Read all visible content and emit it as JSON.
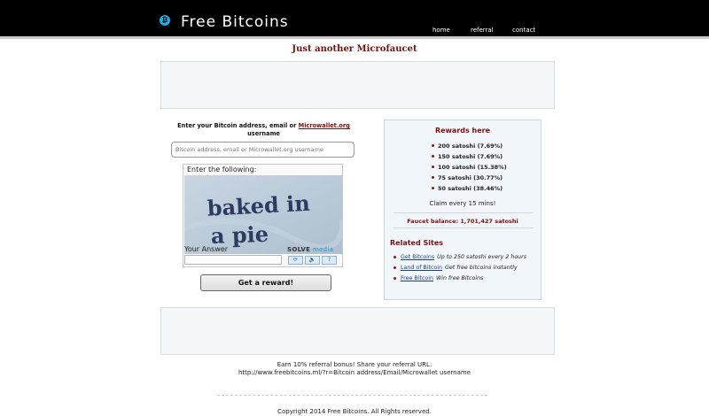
{
  "header": {
    "logo_glyph": "₿",
    "title": "Free Bitcoins",
    "nav": {
      "home": "home",
      "referral": "referral",
      "contact": "contact"
    }
  },
  "subtitle": "Just another Microfaucet",
  "form": {
    "label_prefix": "Enter your Bitcoin address, email or ",
    "label_link": "Microwallet.org",
    "label_suffix": " username",
    "address_placeholder": "Bitcoin address, email or Microwallet.org username",
    "address_value": ""
  },
  "captcha": {
    "prompt": "Enter the following:",
    "challenge_line1": "baked in",
    "challenge_line2": "a pie",
    "answer_label": "Your Answer",
    "brand_bold": "SOLVE",
    "brand_light": "media",
    "refresh_glyph": "⟳",
    "audio_glyph": "🔈",
    "help_glyph": "?"
  },
  "reward_button_label": "Get a reward!",
  "rewards": {
    "title": "Rewards here",
    "items": [
      "200 satoshi (7.69%)",
      "150 satoshi (7.69%)",
      "100 satoshi (15.38%)",
      "75 satoshi (30.77%)",
      "50 satoshi (38.46%)"
    ],
    "claim_text": "Claim every 15 mins!",
    "faucet_balance": "Faucet balance: 1,701,427 satoshi"
  },
  "related": {
    "title": "Related Sites",
    "items": [
      {
        "link": "Get Bitcoins",
        "desc": "Up to 250 satoshi every 2 hours"
      },
      {
        "link": "Land of Bitcoin",
        "desc": "Get free bitcoins instantly"
      },
      {
        "link": "Free Bitcoin",
        "desc": "Win free Bitcoins"
      }
    ]
  },
  "referral": {
    "line1": "Earn 10% referral bonus! Share your referral URL:",
    "line2": "http://www.freebitcoins.ml/?r=Bitcoin address/Email/Microwallet username"
  },
  "copyright": "Copyright 2014 Free Bitcoins. All Rights reserved.",
  "colors": {
    "header_bg": "#000000",
    "accent": "#7a1010",
    "logo": "#1ab0e8"
  }
}
